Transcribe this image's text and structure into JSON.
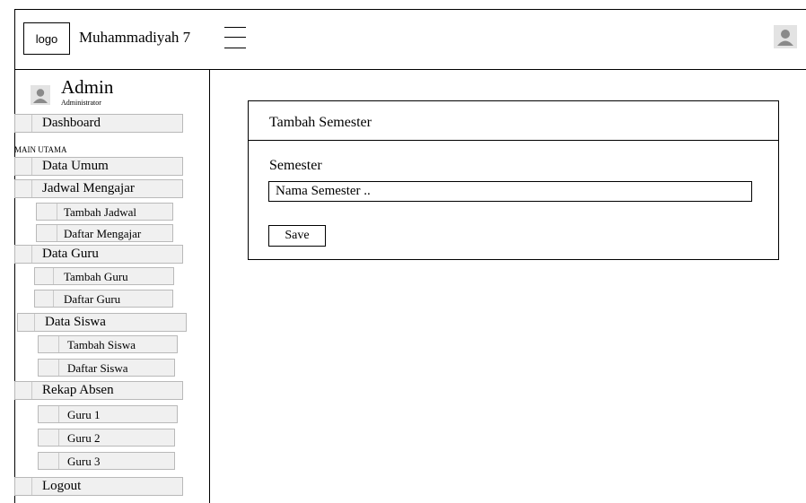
{
  "header": {
    "logo_text": "logo",
    "brand": "Muhammadiyah 7"
  },
  "sidebar": {
    "user": {
      "name": "Admin",
      "role": "Administrator"
    },
    "section_label": "MAIN UTAMA",
    "items": [
      {
        "label": "Dashboard"
      },
      {
        "label": "Data Umum"
      },
      {
        "label": "Jadwal Mengajar"
      },
      {
        "label": "Tambah Jadwal"
      },
      {
        "label": "Daftar Mengajar"
      },
      {
        "label": "Data Guru"
      },
      {
        "label": "Tambah Guru"
      },
      {
        "label": "Daftar Guru"
      },
      {
        "label": "Data Siswa"
      },
      {
        "label": "Tambah Siswa"
      },
      {
        "label": "Daftar Siswa"
      },
      {
        "label": "Rekap Absen"
      },
      {
        "label": "Guru 1"
      },
      {
        "label": "Guru 2"
      },
      {
        "label": "Guru 3"
      },
      {
        "label": "Logout"
      }
    ]
  },
  "main": {
    "panel_title": "Tambah Semester",
    "field_label": "Semester",
    "input_placeholder": "Nama Semester ..",
    "input_value": "",
    "save_label": "Save"
  }
}
